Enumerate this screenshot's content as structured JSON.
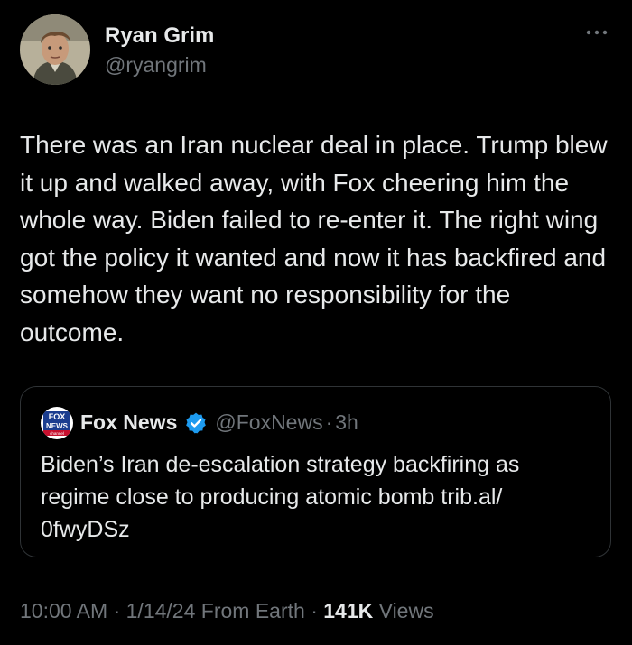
{
  "author": {
    "name": "Ryan Grim",
    "handle": "@ryangrim",
    "avatar_icon": "avatar-portrait"
  },
  "more_icon": "more-horizontal-icon",
  "tweet": {
    "text": "There was an Iran nuclear deal in place. Trump blew it up and walked away, with Fox cheering him the whole way. Biden failed to re-enter it. The right wing got the policy it wanted and now it has backfired and somehow they want no responsibility for the outcome."
  },
  "quote": {
    "logo_icon": "fox-news-logo",
    "logo_text_top": "FOX",
    "logo_text_mid": "NEWS",
    "logo_text_bottom": "channel",
    "name": "Fox News",
    "verified_icon": "verified-badge-icon",
    "handle": "@FoxNews",
    "separator": "·",
    "time": "3h",
    "text": "Biden’s Iran de-escalation strategy backfiring as regime close to producing atomic bomb trib.al/ 0fwyDSz"
  },
  "meta": {
    "time": "10:00 AM",
    "sep1": " · ",
    "date": "1/14/24",
    "source": " From Earth",
    "sep2": " · ",
    "views_count": "141K",
    "views_label": " Views"
  },
  "colors": {
    "background": "#000000",
    "text": "#e7e9ea",
    "muted": "#71767b",
    "border": "#2f3336",
    "verified": "#1d9bf0",
    "fox_blue": "#1b3d8f",
    "fox_red": "#c8102e"
  }
}
